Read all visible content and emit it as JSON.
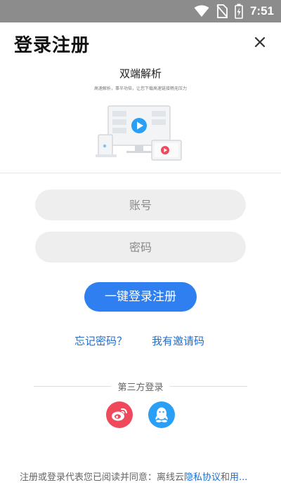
{
  "status_bar": {
    "time": "7:51",
    "icons": [
      "wifi-icon",
      "no-sim-icon",
      "battery-charging-icon"
    ]
  },
  "page": {
    "title": "登录注册",
    "close_icon": "close-icon"
  },
  "promo": {
    "title": "双端解析",
    "subtitle": "高速解析，事半功倍，让您下载高速链接畅无压力",
    "illustration": "devices-play-illustration"
  },
  "form": {
    "account_placeholder": "账号",
    "password_placeholder": "密码",
    "account_value": "",
    "password_value": "",
    "login_button": "一键登录注册"
  },
  "links": {
    "forgot_password": "忘记密码？",
    "invite_code": "我有邀请码"
  },
  "third_party": {
    "label": "第三方登录",
    "providers": [
      {
        "name": "weibo",
        "icon": "weibo-icon",
        "color": "#f1495c"
      },
      {
        "name": "qq",
        "icon": "qq-icon",
        "color": "#2b9ff5"
      }
    ]
  },
  "agreement": {
    "prefix": "注册或登录代表您已阅读并同意：离线云",
    "privacy": "隐私协议",
    "conjunction": "和",
    "user_terms": "用..."
  },
  "colors": {
    "accent": "#2f7ff0",
    "link": "#1e6fd0",
    "status_bar": "#8c8c8c",
    "field_bg": "#eeeeee"
  }
}
